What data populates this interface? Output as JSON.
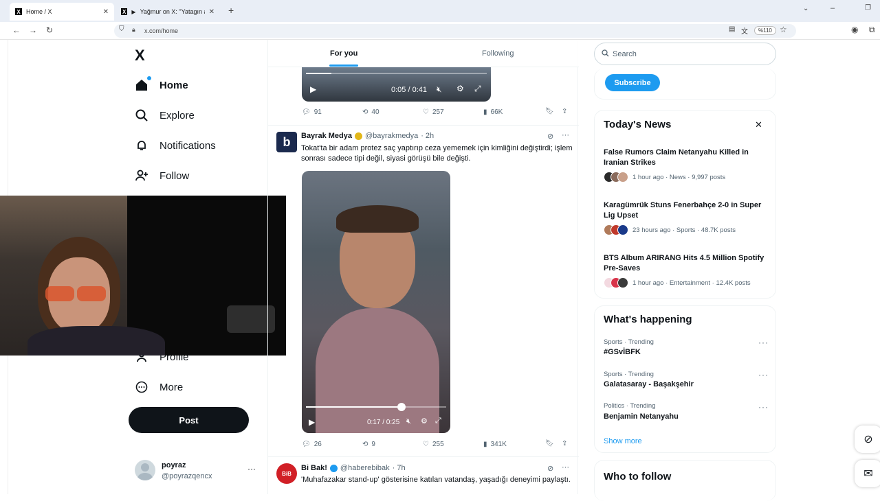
{
  "browser": {
    "tabs": [
      {
        "title": "Home / X",
        "active": true
      },
      {
        "title": "Yağmur on X: \"Yatagın altın",
        "active": false
      }
    ],
    "url": "x.com/home",
    "zoom": "%110"
  },
  "nav": {
    "logo": "X",
    "items": [
      {
        "label": "Home",
        "icon": "home-icon"
      },
      {
        "label": "Explore",
        "icon": "search-icon"
      },
      {
        "label": "Notifications",
        "icon": "bell-icon"
      },
      {
        "label": "Follow",
        "icon": "person-add-icon"
      },
      {
        "label": "Profile",
        "icon": "person-icon"
      },
      {
        "label": "More",
        "icon": "more-circle-icon"
      }
    ],
    "post_label": "Post",
    "account": {
      "name": "poyraz",
      "handle": "@poyrazqencx"
    }
  },
  "feed": {
    "tabs": [
      "For you",
      "Following"
    ],
    "active_tab": "For you",
    "tweets": [
      {
        "video_time": "0:05 / 0:41",
        "video_progress": 0.14,
        "stats": {
          "replies": "91",
          "reposts": "40",
          "likes": "257",
          "views": "66K"
        }
      },
      {
        "name": "Bayrak Medya",
        "handle": "@bayrakmedya",
        "time": "· 2h",
        "text": "Tokat'ta bir adam protez saç yaptırıp ceza yememek için kimliğini değiştirdi; işlem sonrası sadece tipi değil, siyasi görüşü bile değişti.",
        "video_time": "0:17 / 0:25",
        "video_progress": 0.68,
        "stats": {
          "replies": "26",
          "reposts": "9",
          "likes": "255",
          "views": "341K"
        }
      },
      {
        "name": "Bi Bak!",
        "handle": "@haberebibak",
        "time": "· 7h",
        "text": "'Muhafazakar stand-up' gösterisine katılan vatandaş, yaşadığı deneyimi paylaştı."
      }
    ]
  },
  "sidebar": {
    "search_placeholder": "Search",
    "subscribe_label": "Subscribe",
    "news_title": "Today's News",
    "news": [
      {
        "headline": "False Rumors Claim Netanyahu Killed in Iranian Strikes",
        "meta": "1 hour ago · News · 9,997 posts"
      },
      {
        "headline": "Karagümrük Stuns Fenerbahçe 2-0 in Super Lig Upset",
        "meta": "23 hours ago · Sports · 48.7K posts"
      },
      {
        "headline": "BTS Album ARIRANG Hits 4.5 Million Spotify Pre-Saves",
        "meta": "1 hour ago · Entertainment · 12.4K posts"
      }
    ],
    "happening_title": "What's happening",
    "trends": [
      {
        "category": "Sports · Trending",
        "name": "#GSvİBFK"
      },
      {
        "category": "Sports · Trending",
        "name": "Galatasaray - Başakşehir"
      },
      {
        "category": "Politics · Trending",
        "name": "Benjamin Netanyahu"
      }
    ],
    "show_more": "Show more",
    "who_to_follow": "Who to follow"
  }
}
